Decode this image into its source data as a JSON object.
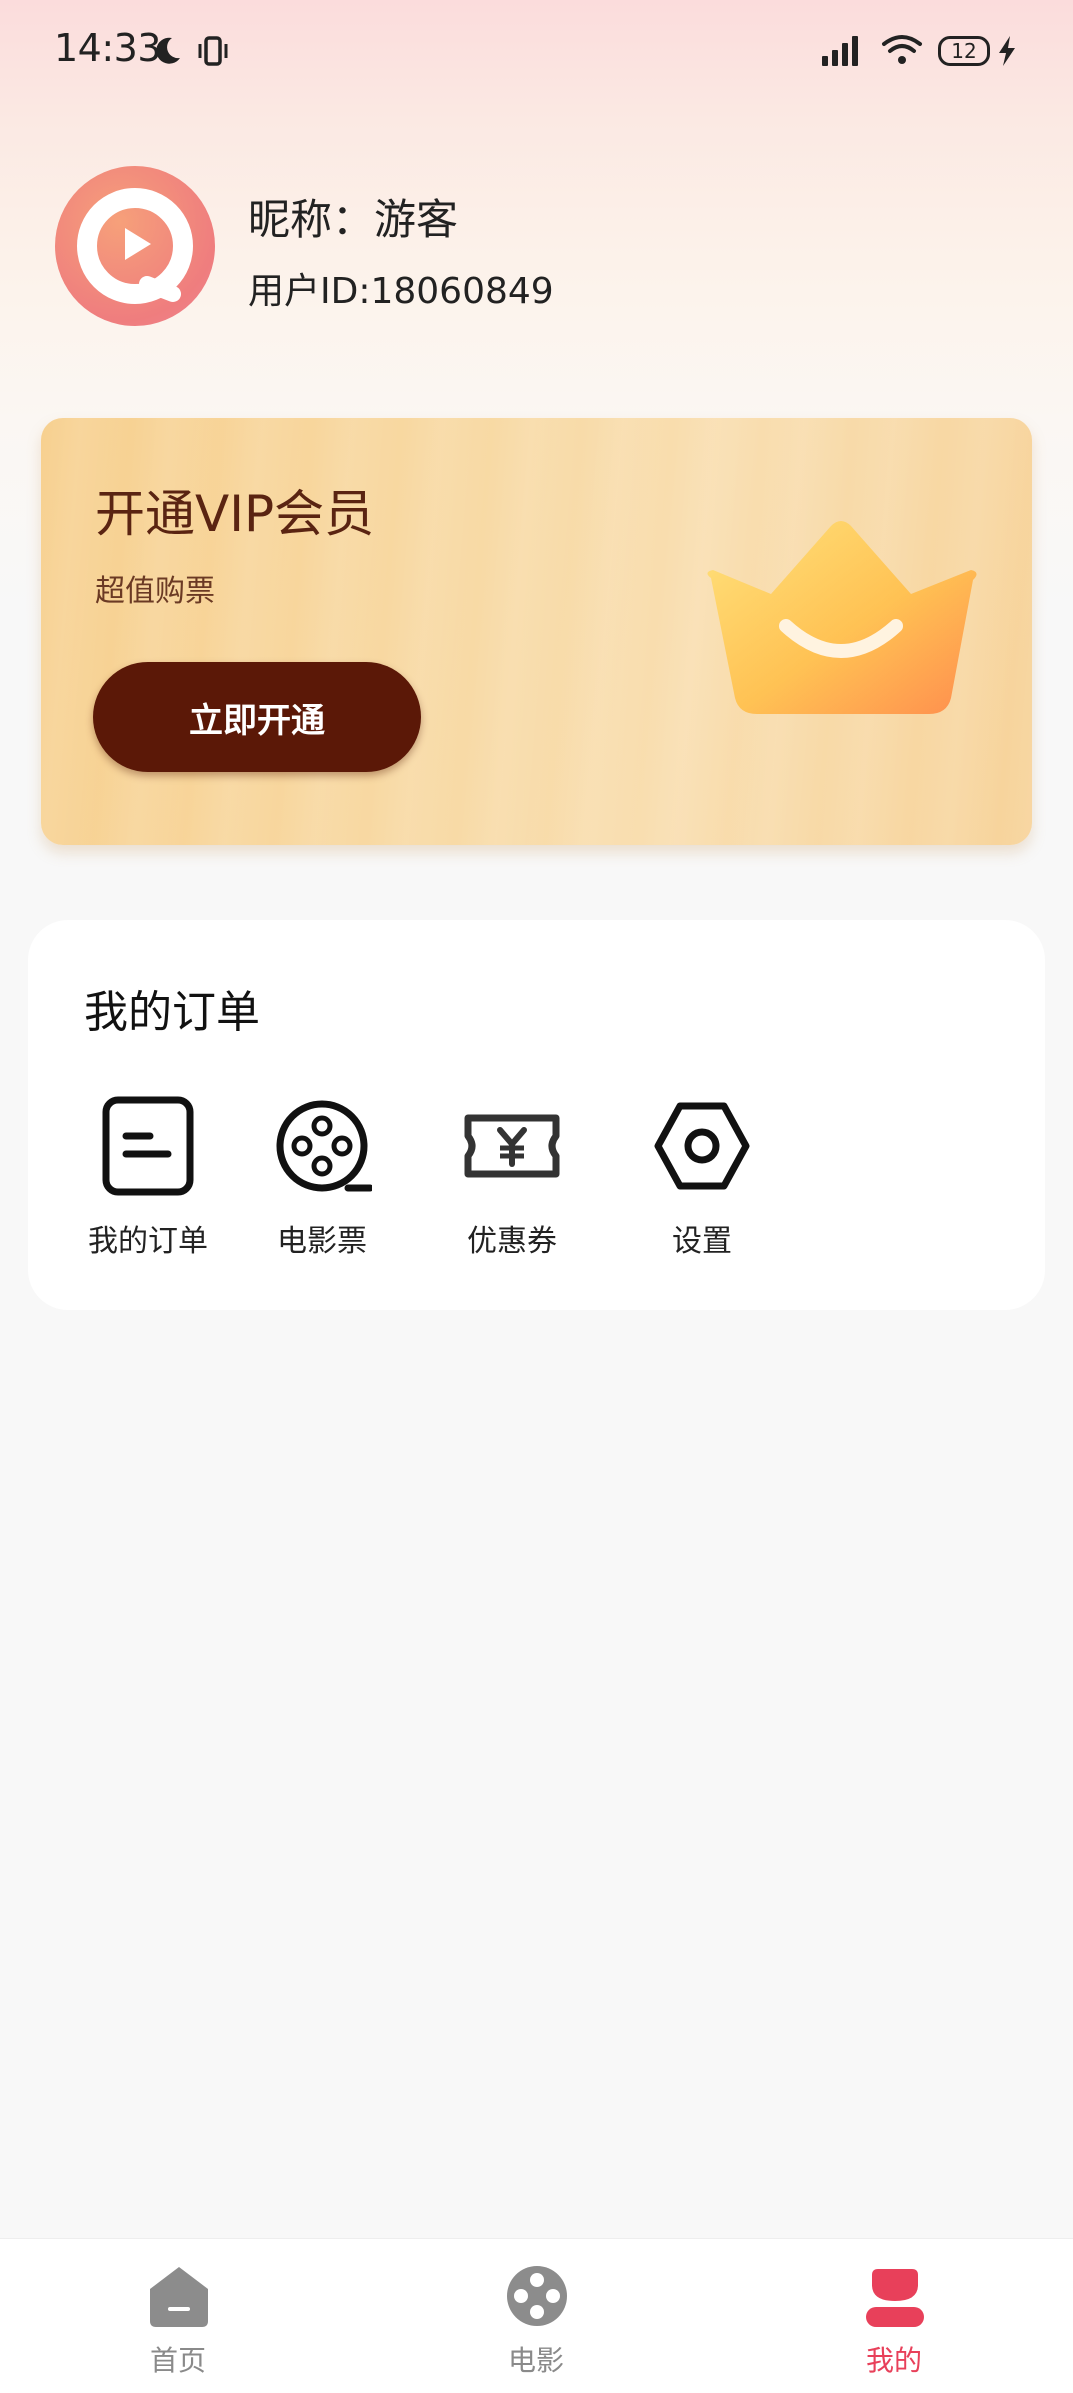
{
  "status_bar": {
    "time": "14:33",
    "battery": "12",
    "icons": [
      "moon-icon",
      "vibrate-icon",
      "signal-icon",
      "wifi-icon",
      "battery-icon",
      "bolt-icon"
    ]
  },
  "profile": {
    "nickname": "昵称：游客",
    "user_id": "用户ID:18060849"
  },
  "vip": {
    "title": "开通VIP会员",
    "subtitle": "超值购票",
    "button": "立即开通",
    "colors": {
      "button": "#5b1807",
      "title": "#5a2412"
    }
  },
  "orders": {
    "title": "我的订单",
    "items": [
      {
        "label": "我的订单",
        "icon": "order-icon"
      },
      {
        "label": "电影票",
        "icon": "film-reel-icon"
      },
      {
        "label": "优惠券",
        "icon": "coupon-icon"
      },
      {
        "label": "设置",
        "icon": "settings-icon"
      }
    ]
  },
  "bottom_nav": {
    "items": [
      {
        "label": "首页",
        "icon": "home-icon"
      },
      {
        "label": "电影",
        "icon": "film-icon"
      },
      {
        "label": "我的",
        "icon": "profile-icon"
      }
    ],
    "active": "我的",
    "active_color": "#e8405a",
    "inactive_color": "#8a8a8a"
  }
}
